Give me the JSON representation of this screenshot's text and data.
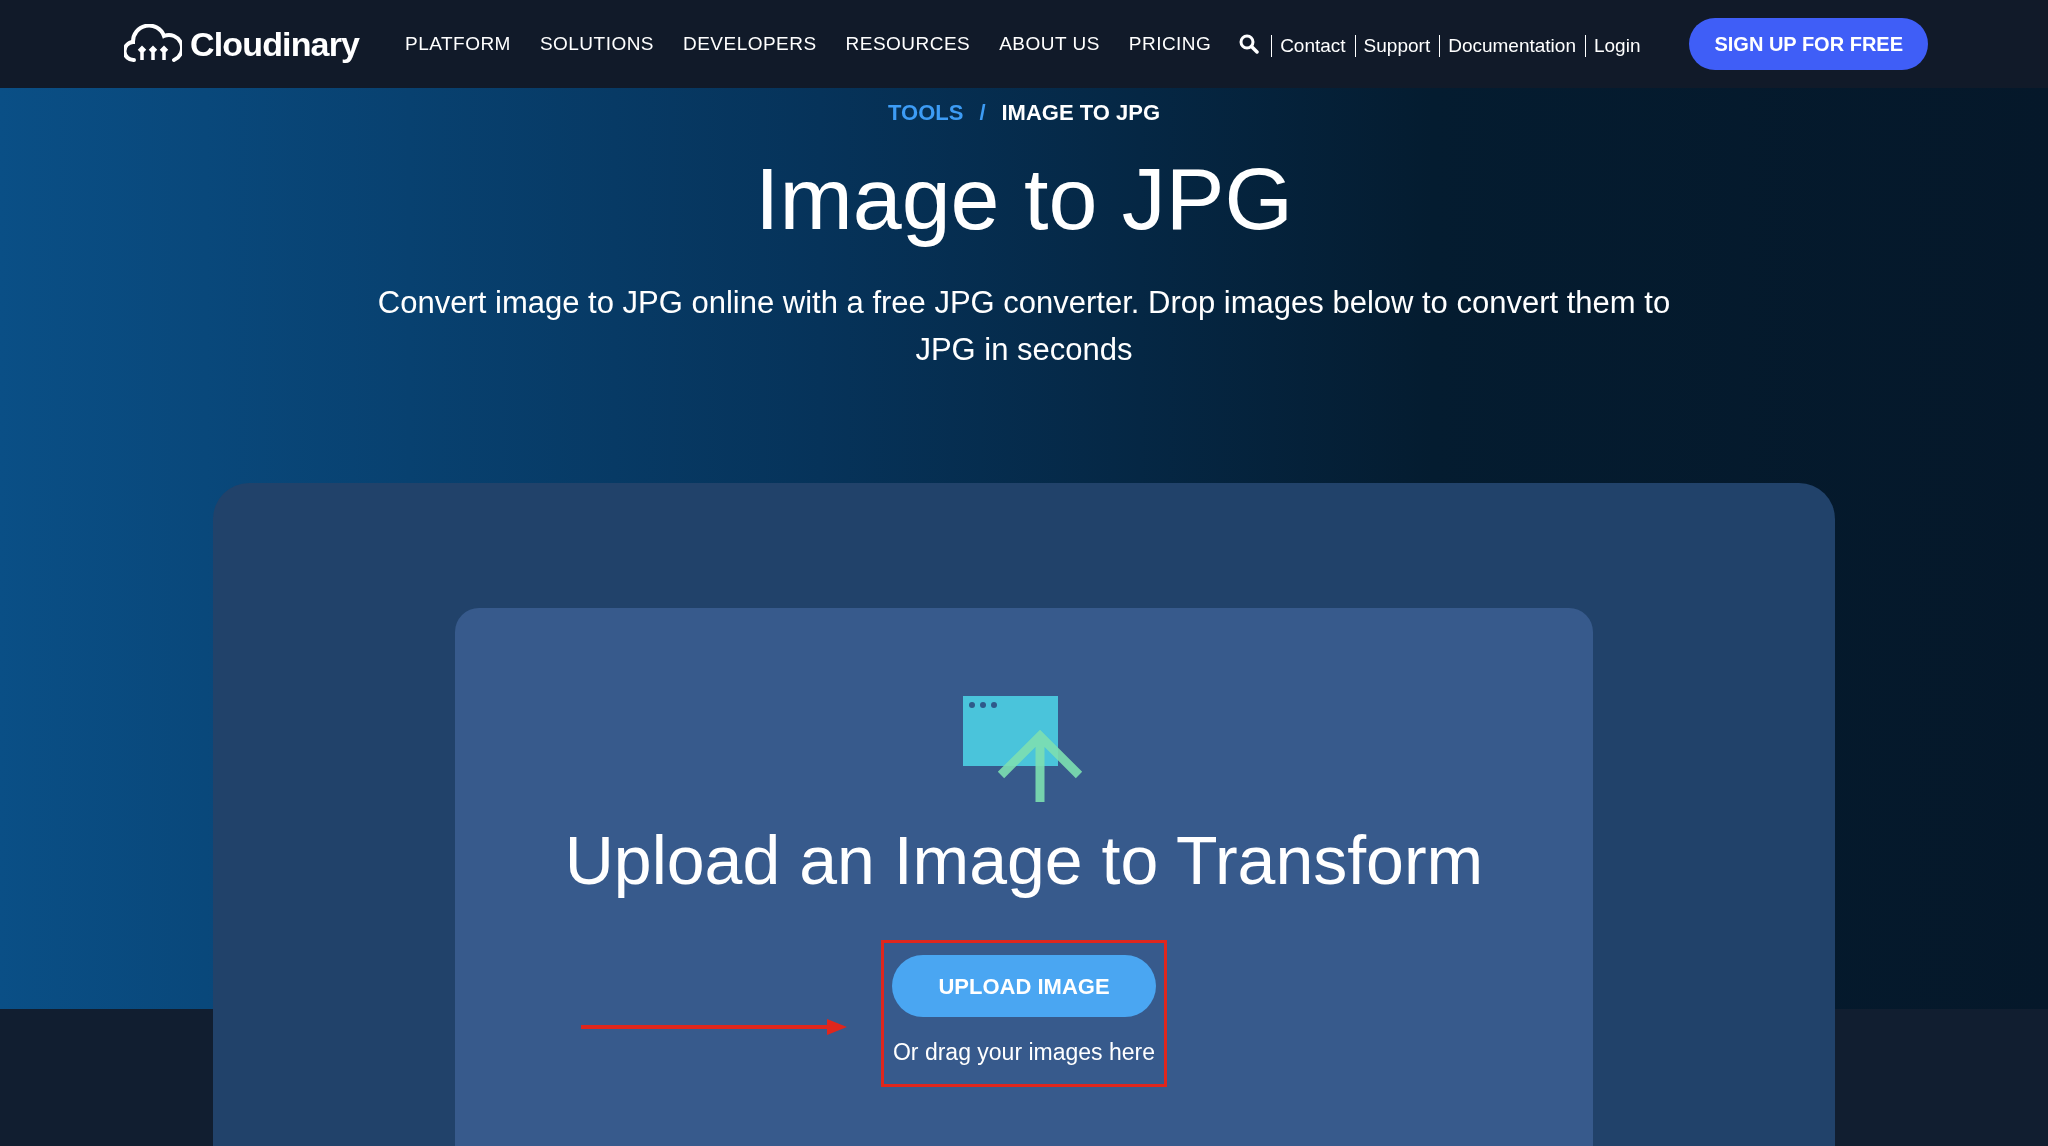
{
  "header": {
    "logo": "Cloudinary",
    "nav": [
      "PLATFORM",
      "SOLUTIONS",
      "DEVELOPERS",
      "RESOURCES",
      "ABOUT US",
      "PRICING"
    ],
    "links": [
      "Contact",
      "Support",
      "Documentation",
      "Login"
    ],
    "cta": "SIGN UP FOR FREE"
  },
  "breadcrumb": {
    "parent": "TOOLS",
    "separator": "/",
    "current": "IMAGE TO JPG"
  },
  "hero": {
    "title": "Image to JPG",
    "subtitle": "Convert image to JPG online with a free JPG converter. Drop images below to convert them to JPG in seconds"
  },
  "upload": {
    "heading": "Upload an Image to Transform",
    "button": "UPLOAD IMAGE",
    "hint": "Or drag your images here"
  },
  "annotation": {
    "highlight": true
  }
}
